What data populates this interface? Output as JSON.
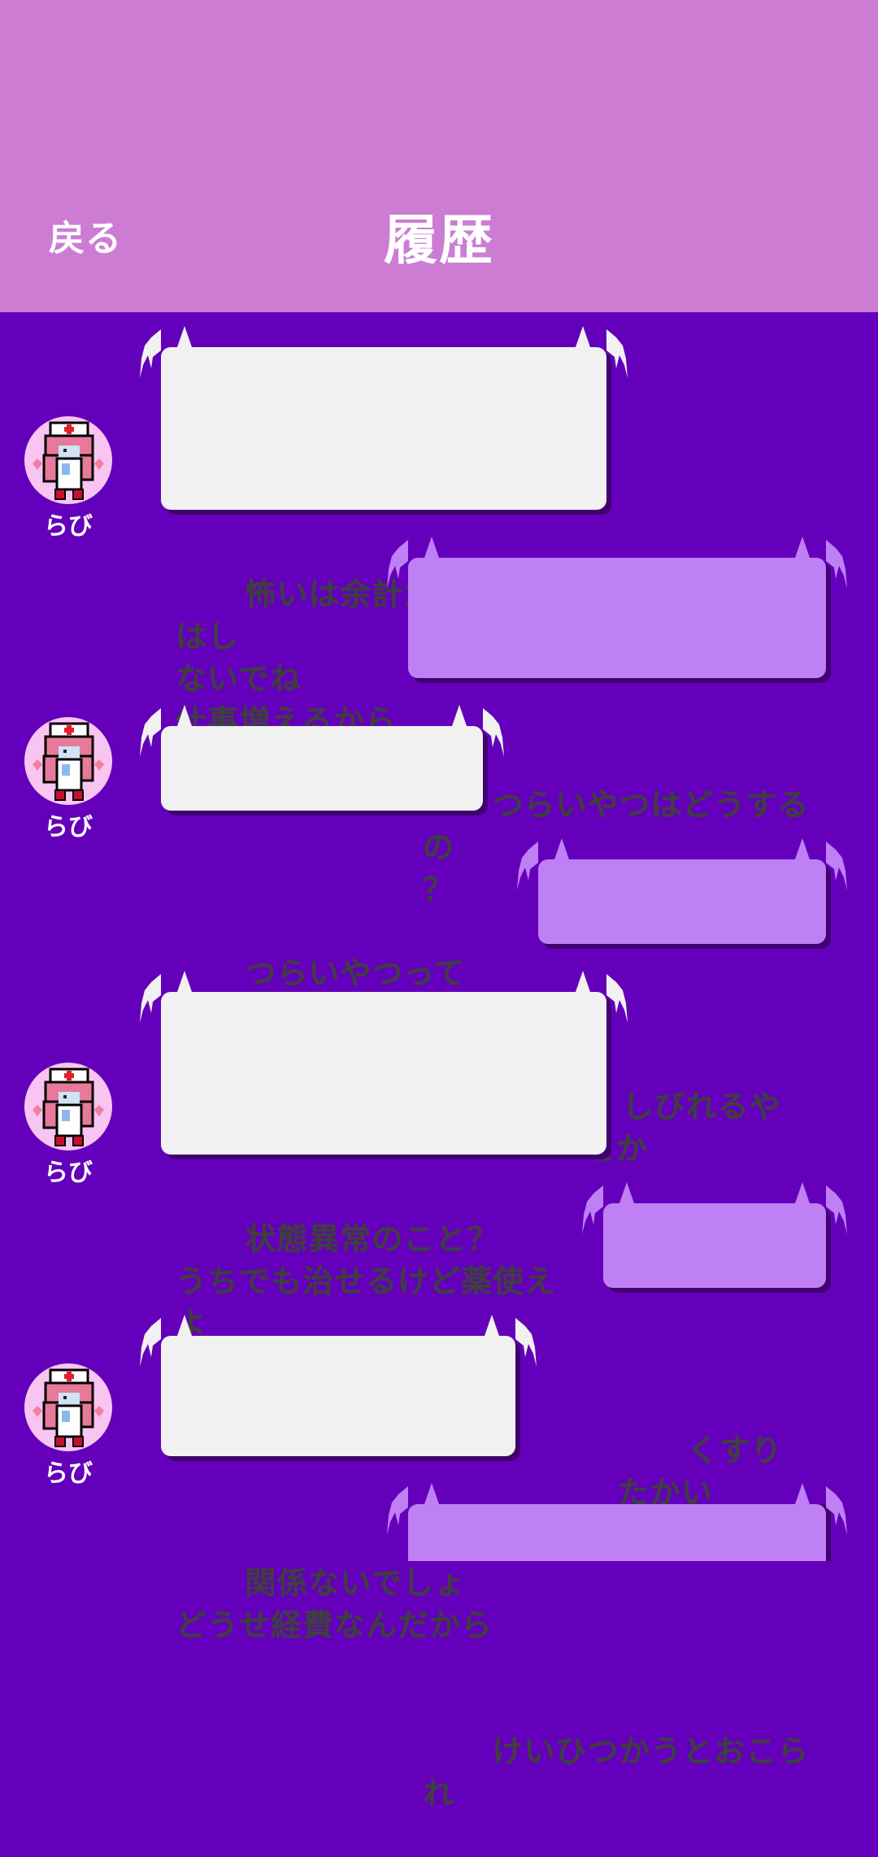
{
  "header": {
    "back_label": "戻る",
    "title": "履歴"
  },
  "colors": {
    "header_bg": "#cc7dd3",
    "page_bg": "#6400bb",
    "npc_bubble": "#f1f1f1",
    "user_bubble": "#bf80f5",
    "bubble_shadow": "#41006f"
  },
  "messages": [
    {
      "speaker": "npc",
      "name": "らび",
      "text": "怖いは余計だけど怪我はし\nないでね\n仕事増えるから"
    },
    {
      "speaker": "user",
      "text": "つらいやつはどうするの\n？"
    },
    {
      "speaker": "npc",
      "name": "らび",
      "text": "つらいやつって何？"
    },
    {
      "speaker": "user",
      "text": "しびれるやつとか"
    },
    {
      "speaker": "npc",
      "name": "らび",
      "text": "状態異常のこと？\nうちでも治せるけど薬使え\nよ"
    },
    {
      "speaker": "user",
      "text": "くすりたかい"
    },
    {
      "speaker": "npc",
      "name": "らび",
      "text": "関係ないでしょ\nどうせ経費なんだから"
    },
    {
      "speaker": "user",
      "text": "けいひつかうとおこられ"
    }
  ]
}
